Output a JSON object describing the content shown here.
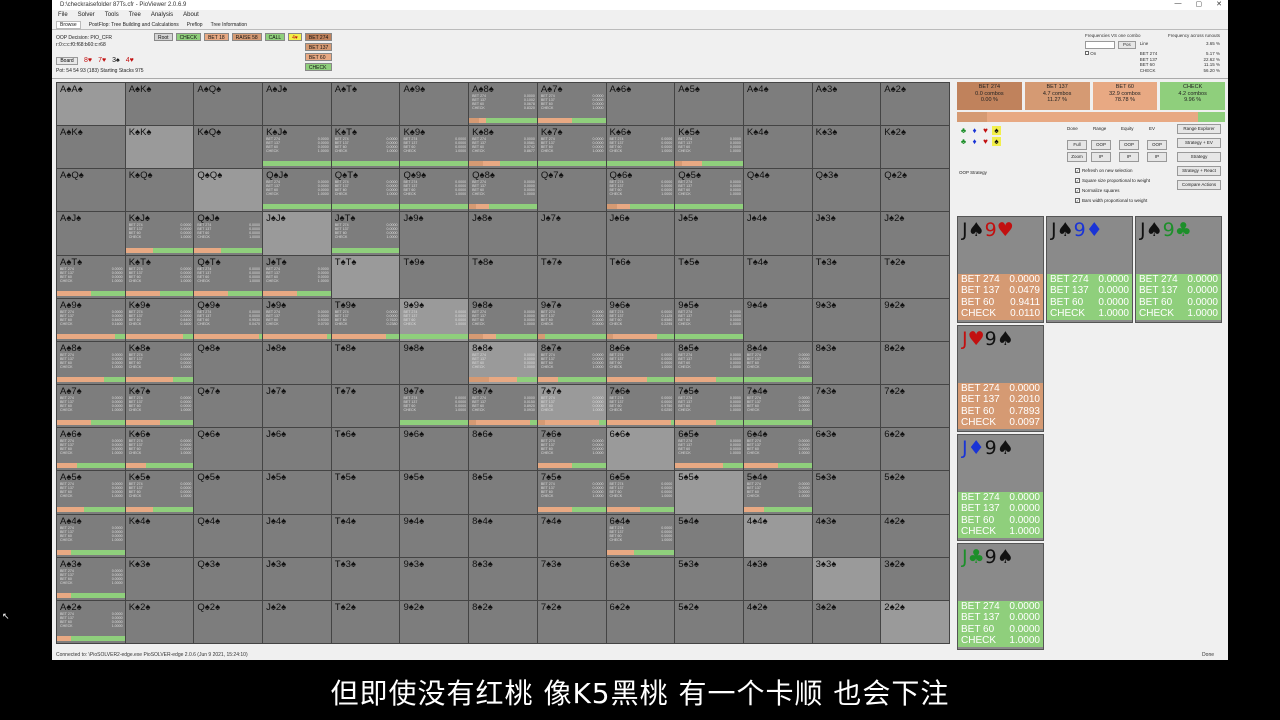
{
  "window": {
    "title": "D:\\checkraisefolder 87Ts.cfr - PioViewer 2.0.6.9",
    "controls": [
      "—",
      "▢",
      "✕"
    ]
  },
  "menu": [
    "File",
    "Solver",
    "Tools",
    "Tree",
    "Analysis",
    "About"
  ],
  "tabs": [
    "Browse",
    "PostFlop: Tree Building and Calculations",
    "Preflop",
    "Tree Information"
  ],
  "oop_info": {
    "decision": "OOP Decision: PIO_CFR",
    "line": "r:0:c:c:f0:f68:b60:c:r68",
    "board_button": "Board",
    "board_cards": [
      "8♥",
      "7♥",
      "3♠",
      "4♥"
    ],
    "pot": "Pot: 54 54 93 (183) Starting Stacks 975"
  },
  "tree_nav": {
    "root": "Root",
    "check": "CHECK",
    "bet18": "BET 18",
    "raise": "RAISE 58",
    "call": "CALL",
    "chip": "4♥",
    "bets": [
      "BET 274",
      "BET 137",
      "BET 60",
      "CHECK"
    ]
  },
  "freq_panel": {
    "title1": "Frequencies VS one combo",
    "title2": "Frequency across runouts",
    "pos_btn": "Pos",
    "on_label": "On",
    "rows": [
      {
        "label": "Line",
        "value": "3.65 %"
      },
      {
        "label": "BET 274",
        "value": "5.17 %"
      },
      {
        "label": "BET 137",
        "value": "22.62 %"
      },
      {
        "label": "BET 60",
        "value": "11.15 %"
      },
      {
        "label": "CHECK",
        "value": "56.20 %"
      }
    ]
  },
  "colors": {
    "bet274": "#c0825c",
    "bet137": "#d59a73",
    "bet60": "#e8a983",
    "check": "#8fcf7c",
    "cell": "#7d7d7d",
    "pair": "#9a9a9a"
  },
  "ranks": [
    "A",
    "K",
    "Q",
    "J",
    "T",
    "9",
    "8",
    "7",
    "6",
    "5",
    "4",
    "3",
    "2"
  ],
  "suits": [
    "♠",
    "♥",
    "♦",
    "♣"
  ],
  "stat_labels": [
    "BET 274",
    "BET 137",
    "BET 60",
    "CHECK"
  ],
  "cells": {
    "0-6": {
      "s": [
        "0.0000",
        "0.1002",
        "0.0678",
        "0.8320"
      ],
      "bar": [
        0,
        15,
        10,
        75
      ]
    },
    "0-7": {
      "s": [
        "0.0000",
        "0.0000",
        "0.0000",
        "1.0000"
      ],
      "bar": [
        0,
        0,
        50,
        50
      ]
    },
    "1-3": {
      "s": [
        "0.0000",
        "0.0000",
        "0.0000",
        "1.0000"
      ],
      "bar": [
        0,
        0,
        0,
        100
      ]
    },
    "1-4": {
      "s": [
        "0.0000",
        "0.0000",
        "0.0000",
        "1.0000"
      ],
      "bar": [
        0,
        0,
        0,
        100
      ]
    },
    "1-5": {
      "s": [
        "0.0000",
        "0.0000",
        "0.0000",
        "1.0000"
      ],
      "bar": [
        0,
        0,
        0,
        100
      ]
    },
    "1-6": {
      "s": [
        "0.0000",
        "0.0581",
        "0.0742",
        "0.8677"
      ],
      "bar": [
        0,
        20,
        25,
        55
      ]
    },
    "1-7": {
      "s": [
        "0.0000",
        "0.0000",
        "0.0000",
        "1.0000"
      ],
      "bar": [
        0,
        0,
        0,
        100
      ]
    },
    "1-8": {
      "s": [
        "0.0000",
        "0.0000",
        "0.0000",
        "1.0000"
      ],
      "bar": [
        0,
        0,
        0,
        100
      ]
    },
    "1-9": {
      "s": [
        "0.0000",
        "0.0000",
        "0.0000",
        "1.0000"
      ],
      "bar": [
        0,
        10,
        30,
        60
      ]
    },
    "2-3": {
      "s": [
        "0.0000",
        "0.0000",
        "0.0000",
        "1.0000"
      ],
      "bar": [
        0,
        0,
        0,
        100
      ]
    },
    "2-4": {
      "s": [
        "0.0000",
        "0.0000",
        "0.0000",
        "1.0000"
      ],
      "bar": [
        0,
        0,
        0,
        100
      ]
    },
    "2-5": {
      "s": [
        "0.0000",
        "0.0000",
        "0.0000",
        "1.0000"
      ],
      "bar": [
        0,
        0,
        0,
        100
      ]
    },
    "2-6": {
      "s": [
        "0.0000",
        "0.0000",
        "0.0000",
        "1.0000"
      ],
      "bar": [
        0,
        10,
        20,
        70
      ]
    },
    "2-8": {
      "s": [
        "0.0000",
        "0.0000",
        "0.0000",
        "1.0000"
      ],
      "bar": [
        0,
        15,
        20,
        65
      ]
    },
    "2-9": {
      "s": [
        "0.0000",
        "0.0000",
        "0.0000",
        "1.0000"
      ],
      "bar": [
        0,
        0,
        0,
        100
      ]
    },
    "3-1": {
      "s": [
        "0.0000",
        "0.0000",
        "0.0000",
        "1.0000"
      ],
      "bar": [
        0,
        0,
        40,
        60
      ]
    },
    "3-2": {
      "s": [
        "0.0000",
        "0.0000",
        "0.0000",
        "1.0000"
      ],
      "bar": [
        0,
        0,
        40,
        60
      ]
    },
    "3-4": {
      "s": [
        "0.0000",
        "0.0000",
        "0.0000",
        "1.0000"
      ],
      "bar": [
        0,
        0,
        0,
        100
      ]
    },
    "4-0": {
      "s": [
        "0.0000",
        "0.0000",
        "0.0000",
        "1.0000"
      ],
      "bar": [
        0,
        0,
        50,
        50
      ]
    },
    "4-1": {
      "s": [
        "0.0000",
        "0.0000",
        "0.0000",
        "1.0000"
      ],
      "bar": [
        0,
        0,
        50,
        50
      ]
    },
    "4-2": {
      "s": [
        "0.0000",
        "0.0000",
        "0.0000",
        "1.0000"
      ],
      "bar": [
        0,
        0,
        50,
        50
      ]
    },
    "4-3": {
      "s": [
        "0.0000",
        "0.0000",
        "0.0000",
        "1.0000"
      ],
      "bar": [
        0,
        0,
        50,
        50
      ]
    },
    "5-0": {
      "s": [
        "0.0000",
        "0.0000",
        "0.8400",
        "0.1600"
      ],
      "bar": [
        0,
        0,
        85,
        15
      ]
    },
    "5-1": {
      "s": [
        "0.0000",
        "0.0000",
        "0.8400",
        "0.1600"
      ],
      "bar": [
        0,
        0,
        85,
        15
      ]
    },
    "5-2": {
      "s": [
        "0.0000",
        "0.0000",
        "0.9530",
        "0.0470"
      ],
      "bar": [
        0,
        0,
        95,
        5
      ]
    },
    "5-3": {
      "s": [
        "0.0000",
        "0.0000",
        "0.9300",
        "0.0700"
      ],
      "bar": [
        0,
        0,
        95,
        5
      ]
    },
    "5-4": {
      "s": [
        "0.0000",
        "0.0000",
        "0.7620",
        "0.2380"
      ],
      "bar": [
        0,
        0,
        80,
        20
      ]
    },
    "5-5": {
      "s": [
        "0.0000",
        "0.0000",
        "0.0000",
        "1.0000"
      ],
      "bar": [
        0,
        0,
        0,
        100
      ]
    },
    "5-6": {
      "s": [
        "0.0000",
        "0.0000",
        "0.0000",
        "1.0000"
      ],
      "bar": [
        0,
        20,
        20,
        60
      ]
    },
    "5-7": {
      "s": [
        "0.0000",
        "0.1000",
        "0.0000",
        "0.9000"
      ],
      "bar": [
        0,
        10,
        0,
        90
      ]
    },
    "5-8": {
      "s": [
        "0.0000",
        "0.1125",
        "0.6580",
        "0.2295"
      ],
      "bar": [
        0,
        10,
        65,
        25
      ]
    },
    "5-9": {
      "s": [
        "0.0000",
        "0.0000",
        "0.0000",
        "1.0000"
      ],
      "bar": [
        0,
        0,
        0,
        100
      ]
    },
    "6-0": {
      "s": [
        "0.0000",
        "0.0000",
        "0.0000",
        "1.0000"
      ],
      "bar": [
        0,
        0,
        70,
        30
      ]
    },
    "6-1": {
      "s": [
        "0.0000",
        "0.0000",
        "0.0000",
        "1.0000"
      ],
      "bar": [
        0,
        0,
        70,
        30
      ]
    },
    "6-6": {
      "s": [
        "0.0000",
        "0.0000",
        "0.0000",
        "1.0000"
      ],
      "bar": [
        0,
        30,
        40,
        30
      ]
    },
    "6-7": {
      "s": [
        "0.0000",
        "0.0000",
        "0.0000",
        "1.0000"
      ],
      "bar": [
        0,
        0,
        30,
        70
      ]
    },
    "6-8": {
      "s": [
        "0.0000",
        "0.0000",
        "0.0000",
        "1.0000"
      ],
      "bar": [
        0,
        0,
        60,
        40
      ]
    },
    "6-9": {
      "s": [
        "0.0000",
        "0.0000",
        "0.0000",
        "1.0000"
      ],
      "bar": [
        0,
        0,
        60,
        40
      ]
    },
    "6-10": {
      "s": [
        "0.0000",
        "0.0000",
        "0.0000",
        "1.0000"
      ],
      "bar": [
        0,
        0,
        0,
        100
      ]
    },
    "7-0": {
      "s": [
        "0.0000",
        "0.0000",
        "0.0000",
        "1.0000"
      ],
      "bar": [
        0,
        0,
        50,
        50
      ]
    },
    "7-1": {
      "s": [
        "0.0000",
        "0.0000",
        "0.0000",
        "1.0000"
      ],
      "bar": [
        0,
        0,
        50,
        50
      ]
    },
    "7-5": {
      "s": [
        "0.0000",
        "0.0000",
        "0.0000",
        "1.0000"
      ],
      "bar": [
        0,
        0,
        0,
        100
      ]
    },
    "7-6": {
      "s": [
        "0.0000",
        "0.0150",
        "0.8920",
        "0.0930"
      ],
      "bar": [
        0,
        10,
        80,
        10
      ]
    },
    "7-7": {
      "s": [
        "0.0000",
        "0.0000",
        "0.0000",
        "1.0000"
      ],
      "bar": [
        0,
        10,
        80,
        10
      ]
    },
    "7-8": {
      "s": [
        "0.0000",
        "0.0000",
        "0.9750",
        "0.0250"
      ],
      "bar": [
        0,
        0,
        95,
        5
      ]
    },
    "7-9": {
      "s": [
        "0.0000",
        "0.0000",
        "0.0000",
        "1.0000"
      ],
      "bar": [
        0,
        0,
        60,
        40
      ]
    },
    "7-10": {
      "s": [
        "0.0000",
        "0.0000",
        "0.0000",
        "1.0000"
      ],
      "bar": [
        0,
        0,
        0,
        100
      ]
    },
    "8-0": {
      "s": [
        "0.0000",
        "0.0000",
        "0.0000",
        "1.0000"
      ],
      "bar": [
        0,
        0,
        30,
        70
      ]
    },
    "8-1": {
      "s": [
        "0.0000",
        "0.0000",
        "0.0000",
        "1.0000"
      ],
      "bar": [
        0,
        0,
        30,
        70
      ]
    },
    "8-7": {
      "s": [
        "0.0000",
        "0.0000",
        "0.0000",
        "1.0000"
      ],
      "bar": [
        0,
        0,
        50,
        50
      ]
    },
    "8-9": {
      "s": [
        "0.0000",
        "0.0000",
        "0.0000",
        "1.0000"
      ],
      "bar": [
        0,
        0,
        70,
        30
      ]
    },
    "8-10": {
      "s": [
        "0.0000",
        "0.0000",
        "0.0000",
        "1.0000"
      ],
      "bar": [
        0,
        0,
        50,
        50
      ]
    },
    "9-0": {
      "s": [
        "0.0000",
        "0.0000",
        "0.0000",
        "1.0000"
      ],
      "bar": [
        0,
        0,
        40,
        60
      ]
    },
    "9-1": {
      "s": [
        "0.0000",
        "0.0000",
        "0.0000",
        "1.0000"
      ],
      "bar": [
        0,
        0,
        40,
        60
      ]
    },
    "9-7": {
      "s": [
        "0.0000",
        "0.0000",
        "0.0000",
        "1.0000"
      ],
      "bar": [
        0,
        0,
        50,
        50
      ]
    },
    "9-8": {
      "s": [
        "0.0000",
        "0.0000",
        "0.0000",
        "1.0000"
      ],
      "bar": [
        0,
        0,
        50,
        50
      ]
    },
    "9-10": {
      "s": [
        "0.0000",
        "0.0000",
        "0.0000",
        "1.0000"
      ],
      "bar": [
        0,
        0,
        30,
        70
      ]
    },
    "10-0": {
      "s": [
        "0.0000",
        "0.0000",
        "0.0000",
        "1.0000"
      ],
      "bar": [
        0,
        0,
        20,
        80
      ]
    },
    "10-8": {
      "s": [
        "0.0000",
        "0.0000",
        "0.0000",
        "1.0000"
      ],
      "bar": [
        0,
        0,
        40,
        60
      ]
    },
    "11-0": {
      "s": [
        "0.0000",
        "0.0000",
        "0.0000",
        "1.0000"
      ],
      "bar": [
        0,
        0,
        20,
        80
      ]
    },
    "12-0": {
      "s": [
        "0.0000",
        "0.0000",
        "0.0000",
        "1.0000"
      ],
      "bar": [
        0,
        0,
        20,
        80
      ]
    }
  },
  "summary": [
    {
      "label": "BET 274",
      "combos": "0.0 combos",
      "pct": "0.00 %",
      "color": "#c0825c"
    },
    {
      "label": "BET 137",
      "combos": "4.7 combos",
      "pct": "11.27 %",
      "color": "#d59a73"
    },
    {
      "label": "BET 60",
      "combos": "32.9 combos",
      "pct": "78.78 %",
      "color": "#e8a983"
    },
    {
      "label": "CHECK",
      "combos": "4.2 combos",
      "pct": "9.96 %",
      "color": "#8fcf7c"
    }
  ],
  "summary_bar": [
    0,
    11.27,
    78.78,
    9.96
  ],
  "controls": {
    "col_labels": [
      "Done",
      "Range",
      "Equity",
      "EV"
    ],
    "full": "Full",
    "oop1": "OOP",
    "oop2": "OOP",
    "oop3": "OOP",
    "zoom": "Zoom",
    "ip1": "IP",
    "ip2": "IP",
    "ip3": "IP",
    "range_explorer": "Range Explorer",
    "strategy_ev": "Strategy + EV",
    "strategy": "Strategy",
    "strategy_react": "Strategy + React",
    "compare_actions": "Compare Actions",
    "oop_strategy": "OOP Strategy",
    "checks": [
      "Refresh on new selection",
      "Square size proportional to weight",
      "Normalize squares",
      "Bars width proportional to weight"
    ]
  },
  "combos": [
    {
      "cards": [
        {
          "r": "J",
          "s": "♠",
          "c": "#111"
        },
        {
          "r": "9",
          "s": "♥",
          "c": "#c21010"
        }
      ],
      "vals": [
        "0.0000",
        "0.0479",
        "0.9411",
        "0.0110"
      ],
      "bg": "#d59a73"
    },
    {
      "cards": [
        {
          "r": "J",
          "s": "♠",
          "c": "#111"
        },
        {
          "r": "9",
          "s": "♦",
          "c": "#1a34d6"
        }
      ],
      "vals": [
        "0.0000",
        "0.0000",
        "0.0000",
        "1.0000"
      ],
      "bg": "#8fcf7c"
    },
    {
      "cards": [
        {
          "r": "J",
          "s": "♠",
          "c": "#111"
        },
        {
          "r": "9",
          "s": "♣",
          "c": "#1d8f2a"
        }
      ],
      "vals": [
        "0.0000",
        "0.0000",
        "0.0000",
        "1.0000"
      ],
      "bg": "#8fcf7c"
    },
    {
      "cards": [
        {
          "r": "J",
          "s": "♥",
          "c": "#c21010"
        },
        {
          "r": "9",
          "s": "♠",
          "c": "#111"
        }
      ],
      "vals": [
        "0.0000",
        "0.2010",
        "0.7893",
        "0.0097"
      ],
      "bg": "#d59a73"
    },
    {
      "cards": [
        {
          "r": "J",
          "s": "♦",
          "c": "#1a34d6"
        },
        {
          "r": "9",
          "s": "♠",
          "c": "#111"
        }
      ],
      "vals": [
        "0.0000",
        "0.0000",
        "0.0000",
        "1.0000"
      ],
      "bg": "#8fcf7c"
    },
    {
      "cards": [
        {
          "r": "J",
          "s": "♣",
          "c": "#1d8f2a"
        },
        {
          "r": "9",
          "s": "♠",
          "c": "#111"
        }
      ],
      "vals": [
        "0.0000",
        "0.0000",
        "0.0000",
        "1.0000"
      ],
      "bg": "#8fcf7c"
    }
  ],
  "suit_selector": [
    "♣",
    "♦",
    "♥",
    "♠",
    "♣",
    "♦",
    "♥",
    "♠"
  ],
  "status": {
    "left": "Connected to: \\PioSOLVER2-edge.exe PioSOLVER-edge 2.0.6 (Jun 9 2021, 15:24:10)",
    "right": "Done"
  },
  "subtitle": "但即使没有红桃 像K5黑桃  有一个卡顺 也会下注"
}
